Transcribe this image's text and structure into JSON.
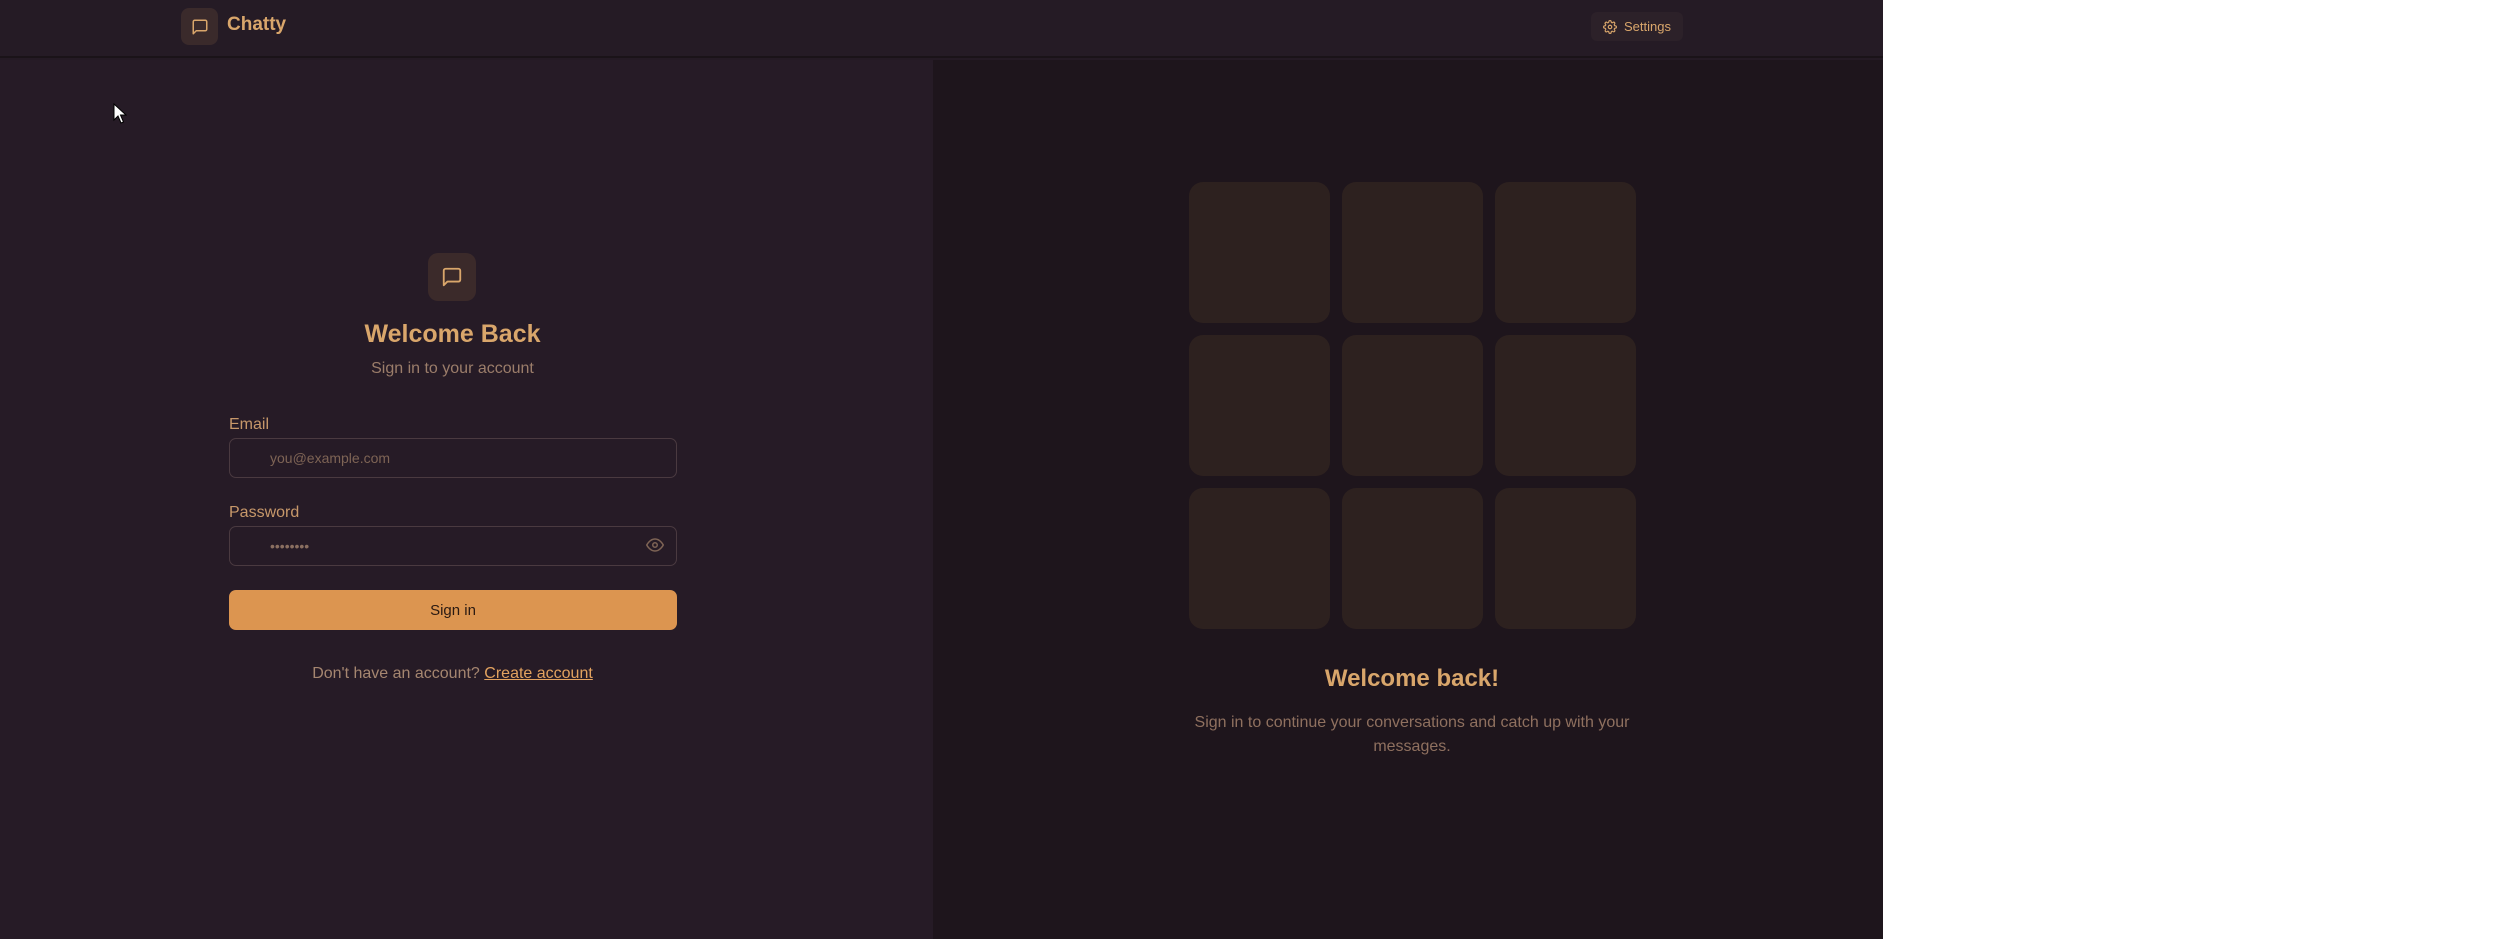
{
  "header": {
    "brand_name": "Chatty",
    "brand_icon": "message-square-icon",
    "settings_label": "Settings",
    "settings_icon": "gear-icon"
  },
  "login": {
    "logo_icon": "message-square-icon",
    "title": "Welcome Back",
    "subtitle": "Sign in to your account",
    "email_label": "Email",
    "email_placeholder": "you@example.com",
    "password_label": "Password",
    "password_value": "••••••••",
    "password_toggle_icon": "eye-icon",
    "submit_label": "Sign in",
    "signup_prompt": "Don't have an account?",
    "signup_link": "Create account"
  },
  "promo": {
    "title": "Welcome back!",
    "subtitle": "Sign in to continue your conversations and catch up with your messages."
  },
  "colors": {
    "accent": "#dc9550",
    "heading": "#d9a66b",
    "background": "#241a24"
  }
}
